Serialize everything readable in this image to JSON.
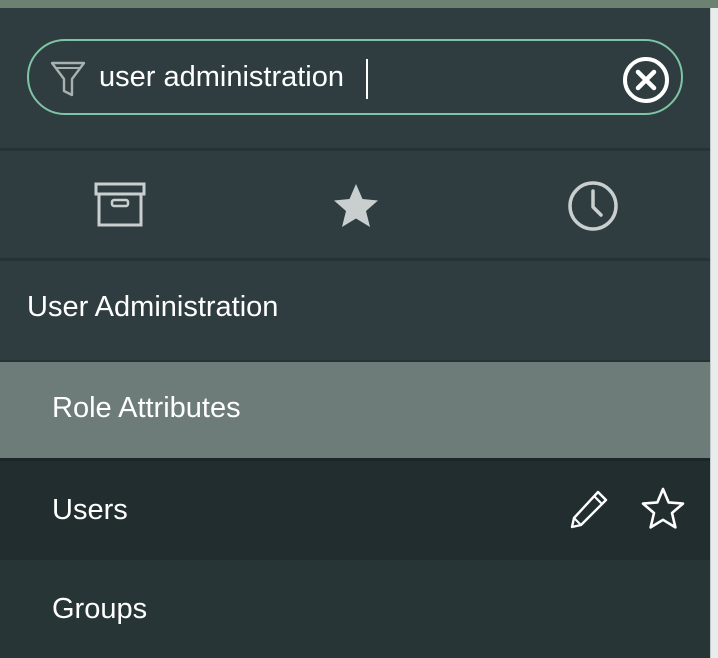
{
  "search": {
    "value": "user administration",
    "filter_icon": "filter-funnel-icon",
    "clear_icon": "clear-circle-x-icon"
  },
  "tabs": [
    {
      "name": "all-applications",
      "icon": "archive-box-icon"
    },
    {
      "name": "favorites",
      "icon": "star-filled-icon"
    },
    {
      "name": "history",
      "icon": "clock-icon"
    }
  ],
  "section": {
    "title": "User Administration"
  },
  "items": [
    {
      "label": "Role Attributes",
      "state": "selected"
    },
    {
      "label": "Users",
      "state": "hovered",
      "actions": [
        "pencil-icon",
        "star-outline-icon"
      ]
    },
    {
      "label": "Groups",
      "state": "normal"
    }
  ],
  "colors": {
    "accent": "#7fc4a4",
    "panel": "#2f3d40",
    "selected": "#6d7b79",
    "hover": "#222d30"
  }
}
